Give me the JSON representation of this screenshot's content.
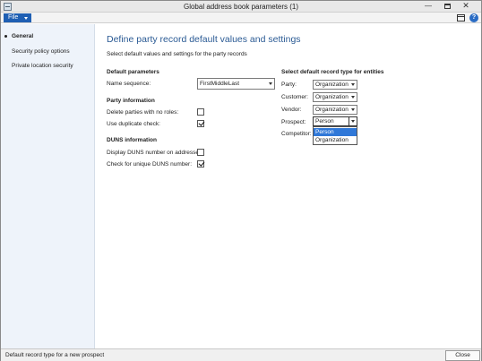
{
  "window": {
    "title": "Global address book parameters (1)",
    "min_glyph": "—",
    "close_glyph": "✕"
  },
  "menubar": {
    "file_label": "File",
    "help_glyph": "?"
  },
  "nav": {
    "items": [
      {
        "label": "General",
        "active": true
      },
      {
        "label": "Security policy options",
        "active": false
      },
      {
        "label": "Private location security",
        "active": false
      }
    ]
  },
  "main": {
    "title": "Define party record default values and settings",
    "subtitle": "Select default values and settings for the party records",
    "default_parameters": {
      "heading": "Default parameters",
      "name_sequence_label": "Name sequence:",
      "name_sequence_value": "FirstMiddleLast"
    },
    "party_information": {
      "heading": "Party information",
      "delete_label": "Delete parties with no roles:",
      "delete_checked": false,
      "duplicate_label": "Use duplicate check:",
      "duplicate_checked": true
    },
    "duns_information": {
      "heading": "DUNS information",
      "display_label": "Display DUNS number on addresses:",
      "display_checked": false,
      "unique_label": "Check for unique DUNS number:",
      "unique_checked": true
    },
    "record_types": {
      "heading": "Select default record type for entities",
      "party_label": "Party:",
      "party_value": "Organization",
      "customer_label": "Customer:",
      "customer_value": "Organization",
      "vendor_label": "Vendor:",
      "vendor_value": "Organization",
      "prospect_label": "Prospect:",
      "prospect_value": "Person",
      "competitor_label": "Competitor:",
      "dropdown_options": [
        "Person",
        "Organization"
      ]
    }
  },
  "status": {
    "text": "Default record type for a new prospect",
    "close_label": "Close"
  }
}
